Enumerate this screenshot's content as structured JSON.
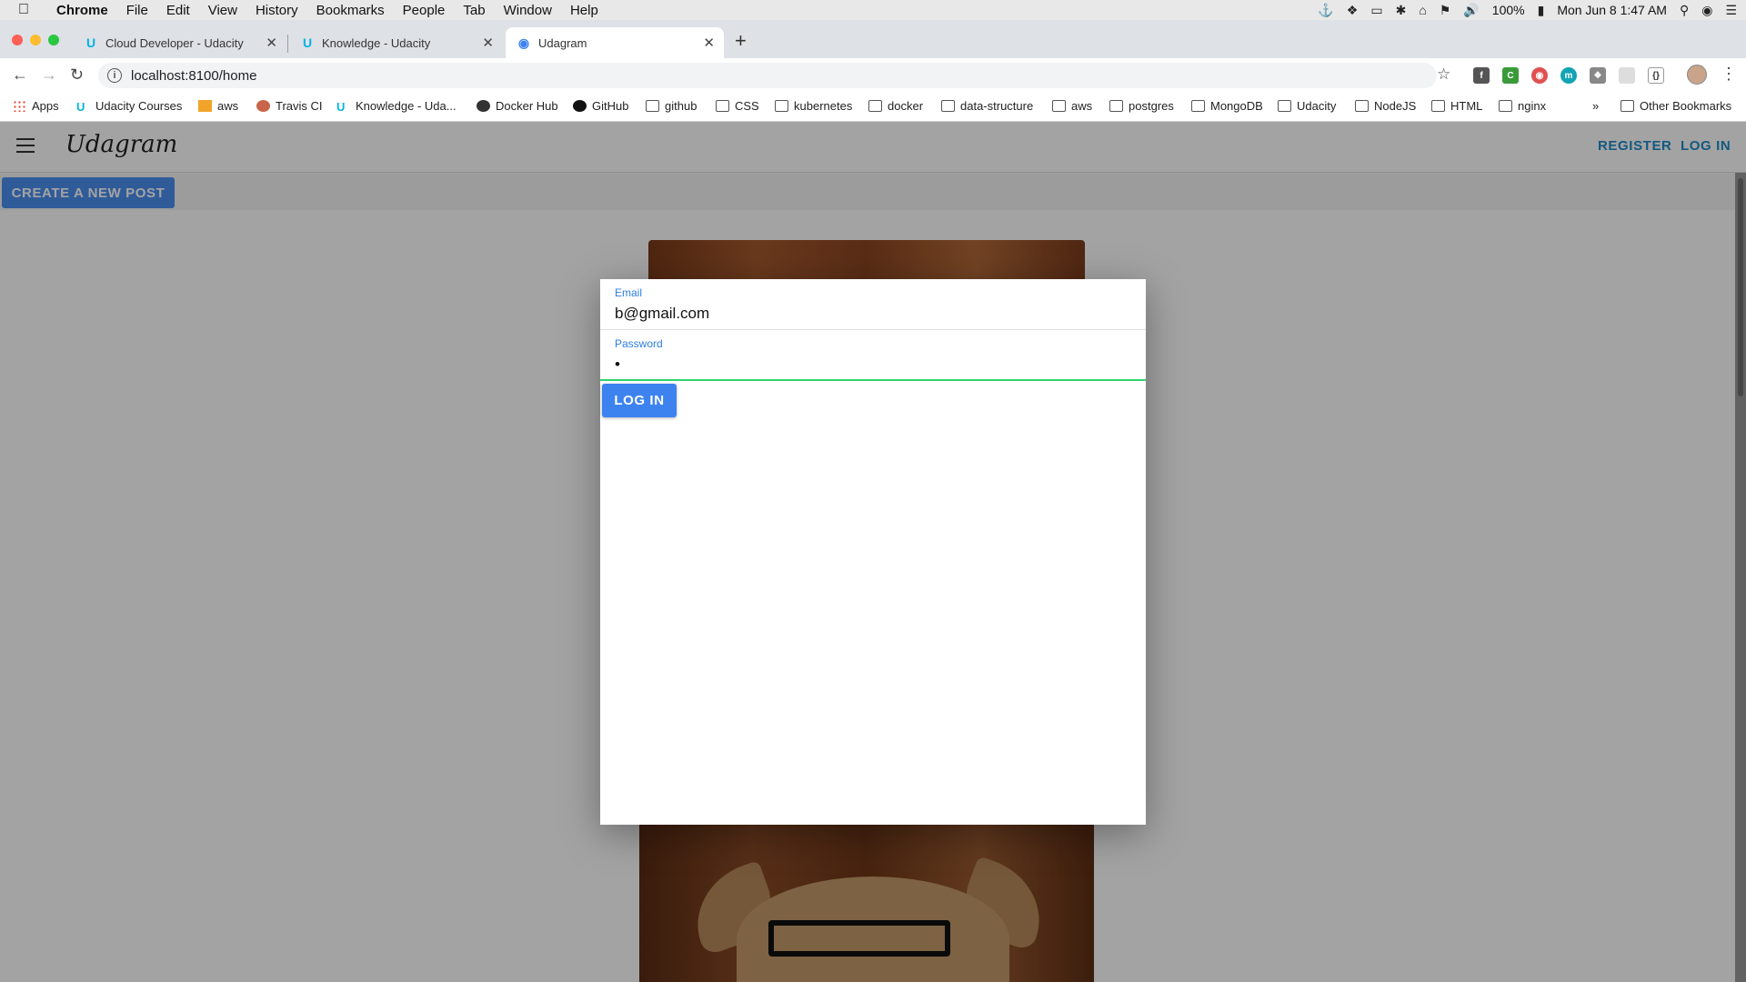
{
  "menubar": {
    "app": "Chrome",
    "items": [
      "File",
      "Edit",
      "View",
      "History",
      "Bookmarks",
      "People",
      "Tab",
      "Window",
      "Help"
    ],
    "battery": "100%",
    "datetime": "Mon Jun 8  1:47 AM"
  },
  "tabs": [
    {
      "title": "Cloud Developer - Udacity"
    },
    {
      "title": "Knowledge - Udacity"
    },
    {
      "title": "Udagram"
    }
  ],
  "address": {
    "url": "localhost:8100/home"
  },
  "bookmarks": {
    "items": [
      "Apps",
      "Udacity Courses",
      "aws",
      "Travis CI",
      "Knowledge - Uda...",
      "Docker Hub",
      "GitHub",
      "github",
      "CSS",
      "kubernetes",
      "docker",
      "data-structure",
      "aws",
      "postgres",
      "MongoDB",
      "Udacity",
      "NodeJS",
      "HTML",
      "nginx"
    ],
    "overflow": "»",
    "other": "Other Bookmarks"
  },
  "app": {
    "brand": "Udagram",
    "register": "REGISTER",
    "login": "LOG IN",
    "create_post": "CREATE A NEW POST"
  },
  "modal": {
    "email_label": "Email",
    "email_value": "b@gmail.com",
    "password_label": "Password",
    "password_value": "•",
    "login_button": "LOG IN"
  },
  "colors": {
    "accent": "#3d83f0",
    "link": "#1f8bc9",
    "focus_underline": "#2dd36f"
  }
}
